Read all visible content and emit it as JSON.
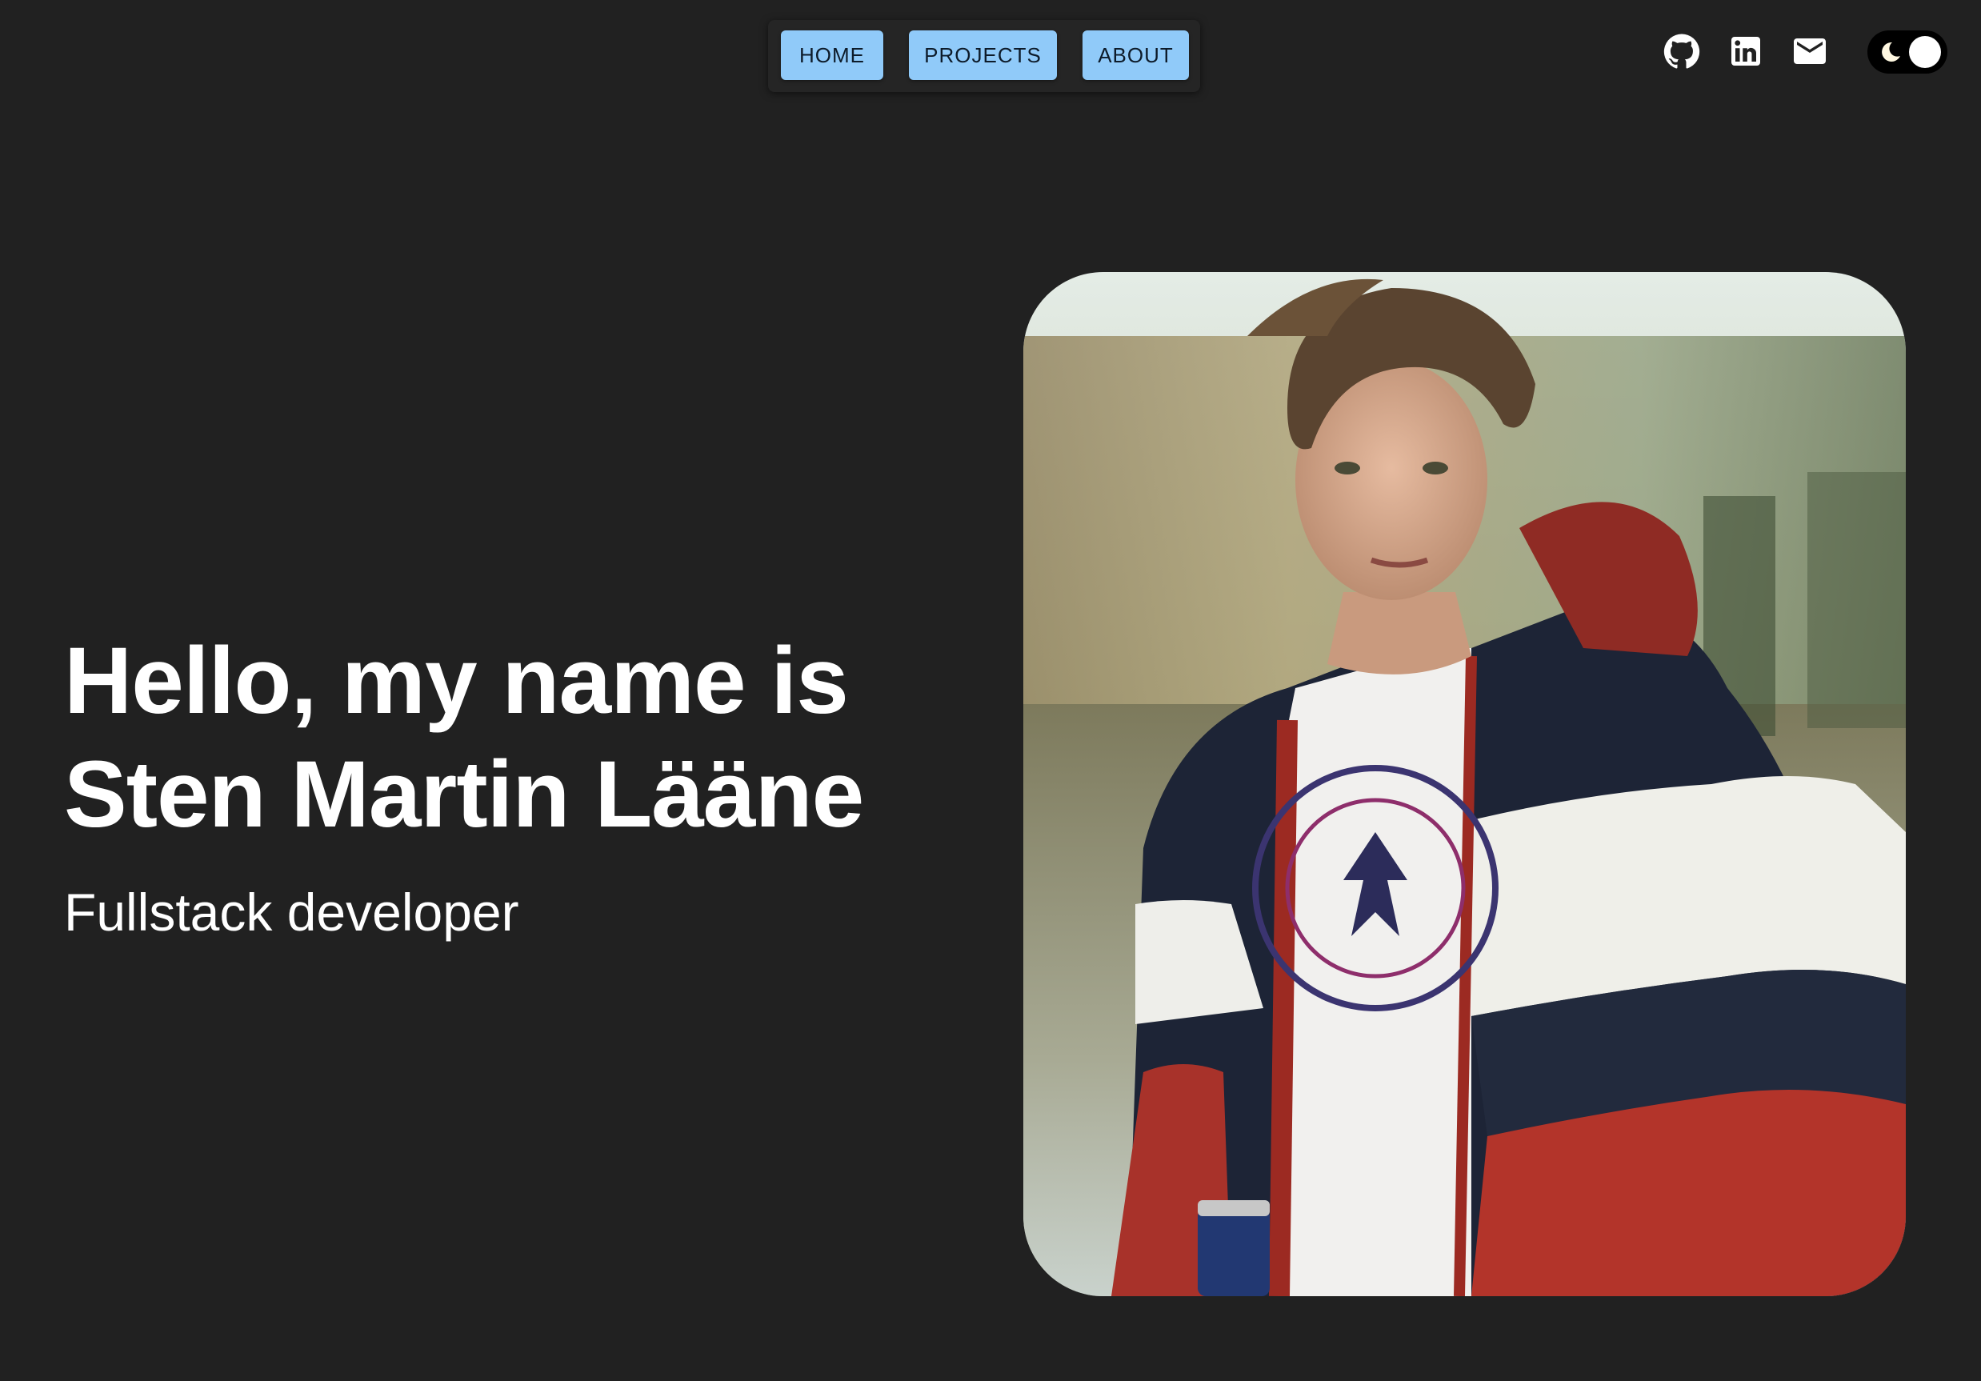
{
  "nav": {
    "items": [
      {
        "label": "HOME"
      },
      {
        "label": "PROJECTS"
      },
      {
        "label": "ABOUT"
      }
    ],
    "button_color": "#90caf9"
  },
  "social": {
    "links": [
      {
        "icon": "github-icon"
      },
      {
        "icon": "linkedin-icon"
      },
      {
        "icon": "email-icon"
      }
    ]
  },
  "theme_toggle": {
    "icon": "moon-icon",
    "mode": "dark"
  },
  "hero": {
    "heading_line1": "Hello, my name is",
    "heading_line2": "Sten Martin Lääne",
    "subtitle": "Fullstack developer"
  },
  "colors": {
    "background": "#212121",
    "text": "#ffffff",
    "accent": "#90caf9"
  }
}
